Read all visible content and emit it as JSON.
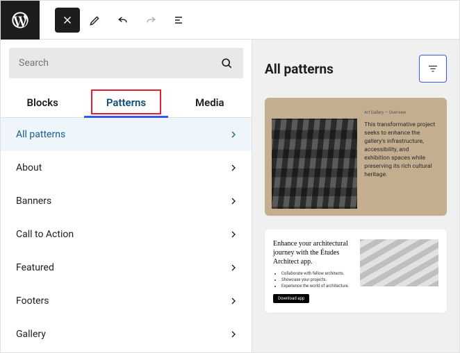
{
  "search": {
    "placeholder": "Search"
  },
  "tabs": {
    "blocks": "Blocks",
    "patterns": "Patterns",
    "media": "Media",
    "active": "patterns"
  },
  "categories": {
    "items": [
      {
        "label": "All patterns",
        "selected": true
      },
      {
        "label": "About"
      },
      {
        "label": "Banners"
      },
      {
        "label": "Call to Action"
      },
      {
        "label": "Featured"
      },
      {
        "label": "Footers"
      },
      {
        "label": "Gallery"
      }
    ]
  },
  "preview": {
    "heading": "All patterns",
    "card1": {
      "kicker": "Art Gallery — Overview",
      "body": "This transformative project seeks to enhance the gallery's infrastructure, accessibility, and exhibition spaces while preserving its rich cultural heritage."
    },
    "card2": {
      "heading": "Enhance your architectural journey with the Études Architect app.",
      "bullets": [
        "Collaborate with fellow architects.",
        "Showcase your projects.",
        "Experience the world of architecture."
      ],
      "cta": "Download app"
    }
  }
}
